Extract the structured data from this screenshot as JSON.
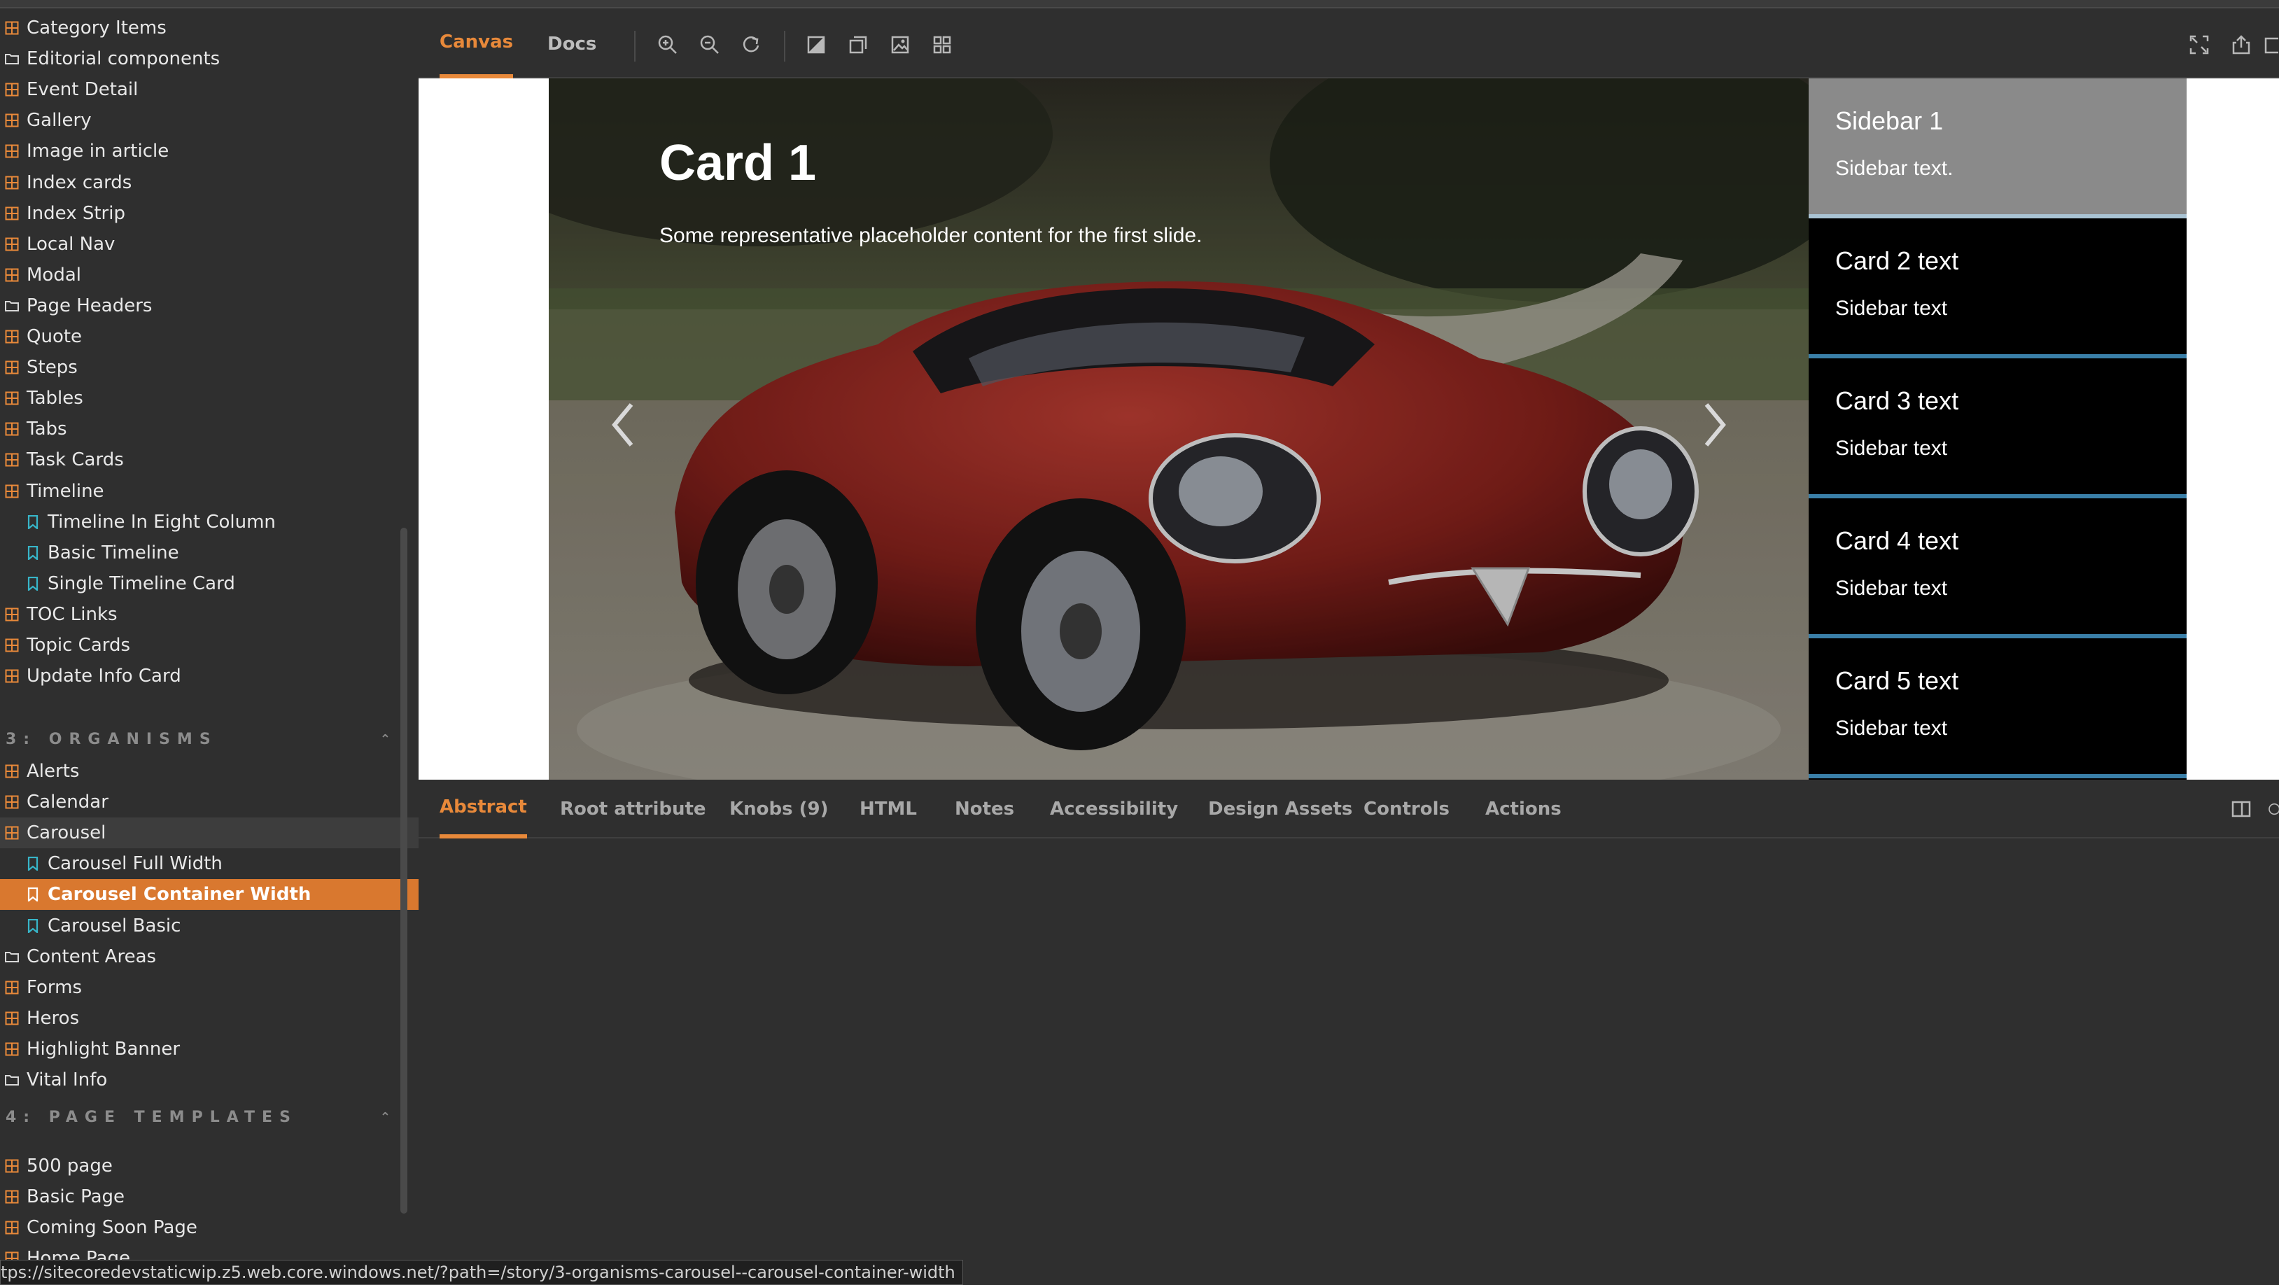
{
  "sidebar": {
    "items_top": [
      {
        "label": "Category Items",
        "icon": "component-icon"
      },
      {
        "label": "Editorial components",
        "icon": "folder-icon"
      },
      {
        "label": "Event Detail",
        "icon": "component-icon"
      },
      {
        "label": "Gallery",
        "icon": "component-icon"
      },
      {
        "label": "Image in article",
        "icon": "component-icon"
      },
      {
        "label": "Index cards",
        "icon": "component-icon"
      },
      {
        "label": "Index Strip",
        "icon": "component-icon"
      },
      {
        "label": "Local Nav",
        "icon": "component-icon"
      },
      {
        "label": "Modal",
        "icon": "component-icon"
      },
      {
        "label": "Page Headers",
        "icon": "folder-icon"
      },
      {
        "label": "Quote",
        "icon": "component-icon"
      },
      {
        "label": "Steps",
        "icon": "component-icon"
      },
      {
        "label": "Tables",
        "icon": "component-icon"
      },
      {
        "label": "Tabs",
        "icon": "component-icon"
      },
      {
        "label": "Task Cards",
        "icon": "component-icon"
      },
      {
        "label": "Timeline",
        "icon": "component-icon"
      },
      {
        "label": "Timeline In Eight Column",
        "icon": "bookmark-icon"
      },
      {
        "label": "Basic Timeline",
        "icon": "bookmark-icon"
      },
      {
        "label": "Single Timeline Card",
        "icon": "bookmark-icon"
      },
      {
        "label": "TOC Links",
        "icon": "component-icon"
      },
      {
        "label": "Topic Cards",
        "icon": "component-icon"
      },
      {
        "label": "Update Info Card",
        "icon": "component-icon"
      }
    ],
    "section_organisms": "3: ORGANISMS",
    "items_organisms": [
      {
        "label": "Alerts",
        "icon": "component-icon"
      },
      {
        "label": "Calendar",
        "icon": "component-icon"
      },
      {
        "label": "Carousel",
        "icon": "component-icon"
      },
      {
        "label": "Carousel Full Width",
        "icon": "bookmark-icon"
      },
      {
        "label": "Carousel Container Width",
        "icon": "bookmark-icon"
      },
      {
        "label": "Carousel Basic",
        "icon": "bookmark-icon"
      },
      {
        "label": "Content Areas",
        "icon": "folder-icon"
      },
      {
        "label": "Forms",
        "icon": "component-icon"
      },
      {
        "label": "Heros",
        "icon": "component-icon"
      },
      {
        "label": "Highlight Banner",
        "icon": "component-icon"
      },
      {
        "label": "Vital Info",
        "icon": "folder-icon"
      }
    ],
    "section_templates": "4: PAGE TEMPLATES",
    "items_templates": [
      {
        "label": "500 page",
        "icon": "component-icon"
      },
      {
        "label": "Basic Page",
        "icon": "component-icon"
      },
      {
        "label": "Coming Soon Page",
        "icon": "component-icon"
      },
      {
        "label": "Home Page",
        "icon": "component-icon"
      }
    ]
  },
  "toolbar": {
    "tab_canvas": "Canvas",
    "tab_docs": "Docs"
  },
  "carousel": {
    "title": "Card 1",
    "description": "Some representative placeholder content for the first slide.",
    "side_cards": [
      {
        "title": "Sidebar 1",
        "text": "Sidebar text."
      },
      {
        "title": "Card 2 text",
        "text": "Sidebar text"
      },
      {
        "title": "Card 3 text",
        "text": "Sidebar text"
      },
      {
        "title": "Card 4 text",
        "text": "Sidebar text"
      },
      {
        "title": "Card 5 text",
        "text": "Sidebar text"
      }
    ]
  },
  "addons": {
    "tabs": [
      "Abstract",
      "Root attribute",
      "Knobs (9)",
      "HTML",
      "Notes",
      "Accessibility",
      "Design Assets",
      "Controls",
      "Actions"
    ]
  },
  "status_url": "tps://sitecoredevstaticwip.z5.web.core.windows.net/?path=/story/3-organisms-carousel--carousel-container-width",
  "colors": {
    "accent": "#e8893a",
    "active_row": "#d9782f",
    "icon_orange": "#e8893a",
    "icon_teal": "#37b6c9"
  }
}
